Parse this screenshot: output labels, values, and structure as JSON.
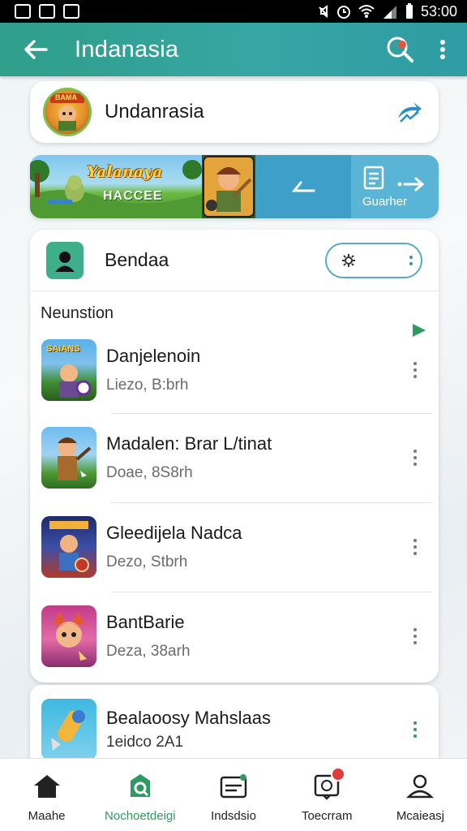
{
  "status_bar": {
    "time": "53:00"
  },
  "app_bar": {
    "title": "Indanasia",
    "back_icon": "arrow-left-icon",
    "search_icon": "search-icon",
    "menu_icon": "more-vert-icon"
  },
  "header_card": {
    "title": "Undanrasia",
    "logo_text": "BAMA",
    "share_icon": "share-icon"
  },
  "banner": {
    "headline": "Yalanaya",
    "subhead": "HACCEE",
    "cta_label": "Guarher",
    "colors": {
      "art_bg": "#7fc6ef",
      "mid": "#3ea0c9",
      "cta": "#5ab4d6"
    }
  },
  "list": {
    "header_title": "Bendaa",
    "section_label": "Neunstion",
    "items": [
      {
        "title": "Danjelenoin",
        "subtitle": "Liezo, B:brh",
        "icon_text": "SAIANS"
      },
      {
        "title": "Madalen: Brar L/tinat",
        "subtitle": "Doae, 8S8rh"
      },
      {
        "title": "Gleedijela Nadca",
        "subtitle": "Dezo, Stbrh"
      },
      {
        "title": "BantBarie",
        "subtitle": "Deza, 38arh"
      }
    ]
  },
  "extra_item": {
    "title": "Bealaoosy Mahslaas",
    "subtitle": "1eidco 2A1"
  },
  "bottom_nav": {
    "items": [
      {
        "label": "Maahe",
        "icon": "home-icon"
      },
      {
        "label": "Nochoetdeigi",
        "icon": "store-icon",
        "active": true
      },
      {
        "label": "Indsdsio",
        "icon": "library-icon"
      },
      {
        "label": "Toecrram",
        "icon": "notifications-icon"
      },
      {
        "label": "Mcaieasj",
        "icon": "profile-icon"
      }
    ]
  },
  "colors": {
    "accent": "#2f9e8a",
    "active_nav": "#2e9a62",
    "badge": "#e23b3b"
  }
}
